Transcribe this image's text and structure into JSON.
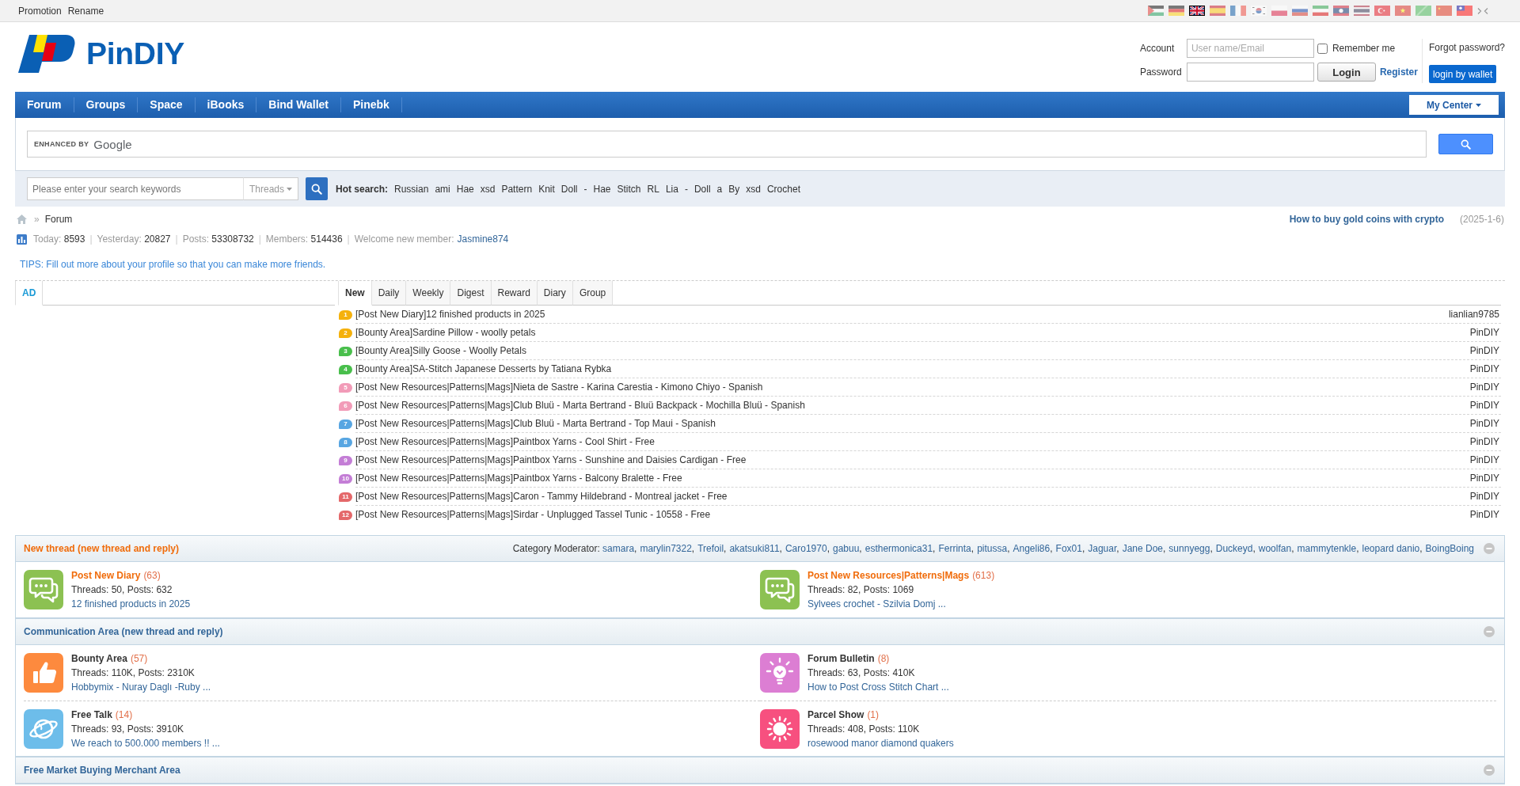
{
  "top_bar": {
    "links": [
      "Promotion",
      "Rename"
    ],
    "languages": [
      {
        "selected": false
      },
      {
        "selected": false
      },
      {
        "selected": true
      },
      {
        "selected": false
      },
      {
        "selected": false
      },
      {
        "selected": false
      },
      {
        "selected": false
      },
      {
        "selected": false
      },
      {
        "selected": false
      },
      {
        "selected": false
      },
      {
        "selected": false
      },
      {
        "selected": false
      },
      {
        "selected": false
      },
      {
        "selected": false
      },
      {
        "selected": false
      },
      {
        "selected": false
      }
    ]
  },
  "header": {
    "site_name": "PinDIY",
    "login": {
      "account_label": "Account",
      "account_placeholder": "User name/Email",
      "remember_label": "Remember me",
      "remember_checked": false,
      "forgot_link": "Forgot password?",
      "password_label": "Password",
      "login_button": "Login",
      "register_link": "Register",
      "wallet_button": "login by wallet"
    }
  },
  "nav": {
    "items": [
      "Forum",
      "Groups",
      "Space",
      "iBooks",
      "Bind Wallet",
      "Pinebk"
    ],
    "my_center": "My Center"
  },
  "site_search": {
    "branding_prefix": "ENHANCED BY",
    "branding_name": "Google"
  },
  "search": {
    "placeholder": "Please enter your search keywords",
    "scope": "Threads",
    "hot_label": "Hot search:",
    "hot_keywords": [
      "Russian",
      "ami",
      "Hae",
      "xsd",
      "Pattern",
      "Knit",
      "Doll",
      "-",
      "Hae",
      "Stitch",
      "RL",
      "Lia",
      "-",
      "Doll",
      "a",
      "By",
      "xsd",
      "Crochet"
    ]
  },
  "breadcrumb": {
    "separator": "»",
    "current": "Forum"
  },
  "announcement": {
    "title": "How to buy gold coins with crypto",
    "date": "(2025-1-6)"
  },
  "stats": {
    "separator": "|",
    "items": [
      {
        "kind": "number",
        "label": "Today:",
        "value": "8593"
      },
      {
        "kind": "number",
        "label": "Yesterday:",
        "value": "20827"
      },
      {
        "kind": "number",
        "label": "Posts:",
        "value": "53308732"
      },
      {
        "kind": "number",
        "label": "Members:",
        "value": "514436"
      },
      {
        "kind": "member",
        "label": "Welcome new member:",
        "value": "Jasmine874"
      }
    ]
  },
  "tips": "TIPS: Fill out more about your profile so that you can make more friends.",
  "ad_panel": {
    "tabs": [
      {
        "label": "AD",
        "selected": true
      }
    ]
  },
  "threads": {
    "tabs": [
      {
        "label": "New",
        "selected": true
      },
      {
        "label": "Daily",
        "selected": false
      },
      {
        "label": "Weekly",
        "selected": false
      },
      {
        "label": "Digest",
        "selected": false
      },
      {
        "label": "Reward",
        "selected": false
      },
      {
        "label": "Diary",
        "selected": false
      },
      {
        "label": "Group",
        "selected": false
      }
    ],
    "rows": [
      {
        "rank": "1",
        "color": "#f5b10c",
        "title": "[Post New Diary]12 finished products in 2025",
        "author": "lianlian9785"
      },
      {
        "rank": "2",
        "color": "#f5b10c",
        "title": "[Bounty Area]Sardine Pillow - woolly petals",
        "author": "PinDIY"
      },
      {
        "rank": "3",
        "color": "#49bf4c",
        "title": "[Bounty Area]Silly Goose - Woolly Petals",
        "author": "PinDIY"
      },
      {
        "rank": "4",
        "color": "#49bf4c",
        "title": "[Bounty Area]SA-Stitch Japanese Desserts by Tatiana Rybka",
        "author": "PinDIY"
      },
      {
        "rank": "5",
        "color": "#f29bb8",
        "title": "[Post New Resources|Patterns|Mags]Nieta de Sastre - Karina Carestia - Kimono Chiyo - Spanish",
        "author": "PinDIY"
      },
      {
        "rank": "6",
        "color": "#f29bb8",
        "title": "[Post New Resources|Patterns|Mags]Club Bluü - Marta Bertrand - Bluü Backpack - Mochilla Bluü - Spanish",
        "author": "PinDIY"
      },
      {
        "rank": "7",
        "color": "#58a6e2",
        "title": "[Post New Resources|Patterns|Mags]Club Bluü - Marta Bertrand - Top Maui - Spanish",
        "author": "PinDIY"
      },
      {
        "rank": "8",
        "color": "#58a6e2",
        "title": "[Post New Resources|Patterns|Mags]Paintbox Yarns - Cool Shirt - Free",
        "author": "PinDIY"
      },
      {
        "rank": "9",
        "color": "#c47ed6",
        "title": "[Post New Resources|Patterns|Mags]Paintbox Yarns - Sunshine and Daisies Cardigan - Free",
        "author": "PinDIY"
      },
      {
        "rank": "10",
        "color": "#c47ed6",
        "title": "[Post New Resources|Patterns|Mags]Paintbox Yarns - Balcony Bralette - Free",
        "author": "PinDIY"
      },
      {
        "rank": "11",
        "color": "#e4686a",
        "title": "[Post New Resources|Patterns|Mags]Caron - Tammy Hildebrand - Montreal jacket - Free",
        "author": "PinDIY"
      },
      {
        "rank": "12",
        "color": "#e4686a",
        "title": "[Post New Resources|Patterns|Mags]Sirdar - Unplugged Tassel Tunic - 10558 - Free",
        "author": "PinDIY"
      }
    ]
  },
  "sections": [
    {
      "title": "New thread (new thread and reply)",
      "highlighted": true,
      "expanded": true,
      "moderator_label": "Category Moderator:",
      "moderator_separator": ",",
      "moderators": [
        "samara",
        "marylin7322",
        "Trefoil",
        "akatsuki811",
        "Caro1970",
        "gabuu",
        "esthermonica31",
        "Ferrinta",
        "pitussa",
        "Angeli86",
        "Fox01",
        "Jaguar",
        "Jane Doe",
        "sunnyegg",
        "Duckeyd",
        "woolfan",
        "mammytenkle",
        "leopard danio",
        "BoingBoing"
      ],
      "forums": [
        {
          "name": "Post New Diary",
          "count": "(63)",
          "stats": "Threads: 50, Posts: 632",
          "last_post": "12 finished products in 2025",
          "color": "#8cc152"
        },
        {
          "name": "Post New Resources|Patterns|Mags",
          "count": "(613)",
          "stats": "Threads: 82, Posts: 1069",
          "last_post": "Sylvees crochet - Szilvia Domj ...",
          "color": "#8cc152"
        }
      ]
    },
    {
      "title": "Communication Area (new thread and reply)",
      "highlighted": false,
      "expanded": true,
      "forums": [
        {
          "name": "Bounty Area",
          "count": "(57)",
          "stats": "Threads: 110K, Posts: 2310K",
          "last_post": "Hobbymix - Nuray Daglı -Ruby ...",
          "color": "#fd8a3e"
        },
        {
          "name": "Forum Bulletin",
          "count": "(8)",
          "stats": "Threads: 63, Posts: 410K",
          "last_post": "How to Post Cross Stitch Chart ...",
          "color": "#dc7ed3"
        },
        {
          "name": "Free Talk",
          "count": "(14)",
          "stats": "Threads: 93, Posts: 3910K",
          "last_post": "We reach to 500.000 members !! ...",
          "color": "#6dbdea"
        },
        {
          "name": "Parcel Show",
          "count": "(1)",
          "stats": "Threads: 408, Posts: 110K",
          "last_post": "rosewood manor diamond quakers",
          "color": "#f7507f"
        }
      ]
    },
    {
      "title": "Free Market Buying Merchant Area",
      "highlighted": false,
      "expanded": true
    }
  ]
}
